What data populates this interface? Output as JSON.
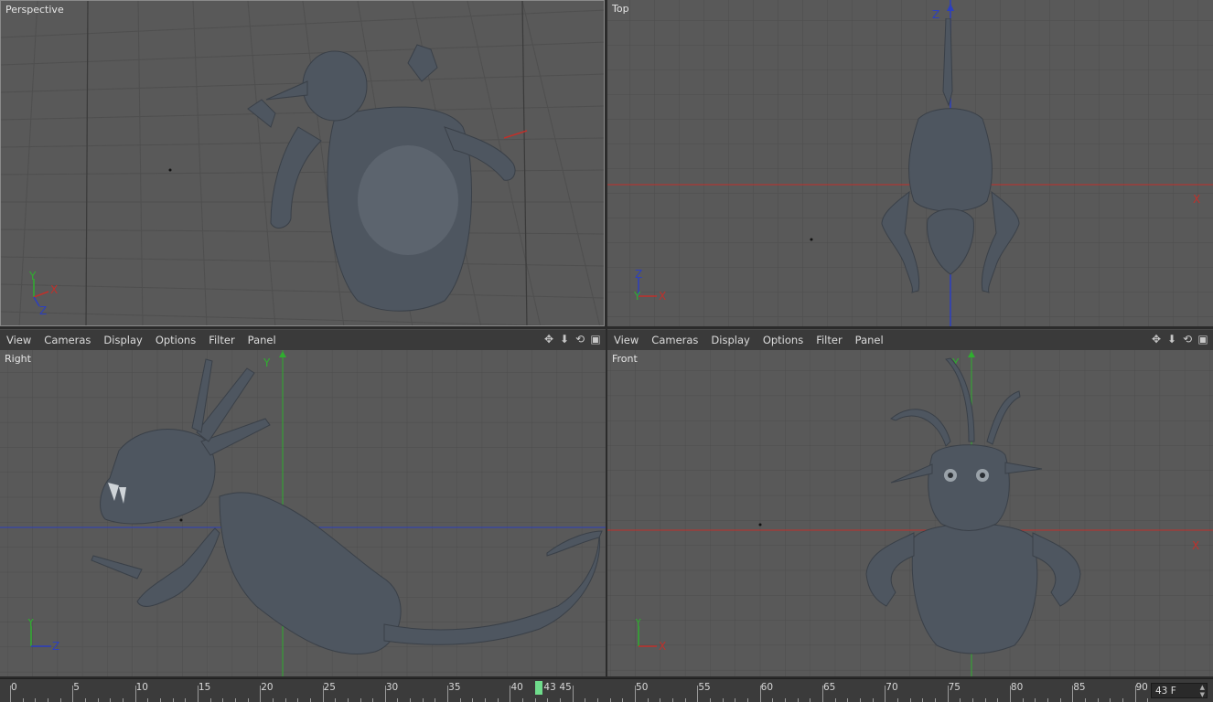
{
  "viewports": {
    "perspective": {
      "label": "Perspective"
    },
    "top": {
      "label": "Top",
      "axis_x": "X",
      "axis_z": "Z"
    },
    "right": {
      "label": "Right",
      "axis_y": "Y"
    },
    "front": {
      "label": "Front",
      "axis_y": "Y",
      "axis_x": "X"
    }
  },
  "gizmos": {
    "perspective": [
      "Y",
      "X",
      "Z"
    ],
    "top": [
      "Z",
      "Y",
      "X"
    ],
    "right": [
      "Y",
      "Z"
    ],
    "front": [
      "Y",
      "X"
    ]
  },
  "menu": [
    "View",
    "Cameras",
    "Display",
    "Options",
    "Filter",
    "Panel"
  ],
  "toolbar_icons": [
    "move-icon",
    "down-arrow-icon",
    "rotate-icon",
    "maximize-icon"
  ],
  "timeline": {
    "ticks": [
      "0",
      "5",
      "10",
      "15",
      "20",
      "25",
      "30",
      "35",
      "40",
      "45",
      "50",
      "55",
      "60",
      "65",
      "70",
      "75",
      "80",
      "85",
      "90"
    ],
    "current_frame_label": "43",
    "current_frame": 43,
    "frame_field": "43 F"
  },
  "colors": {
    "viewport_bg": "#595959",
    "grid": "#4d4d4d",
    "axis_x": "#c0302a",
    "axis_y": "#2fae2f",
    "axis_z": "#2c3fbf",
    "playhead": "#6fdc8c",
    "model": "#4e5660"
  }
}
